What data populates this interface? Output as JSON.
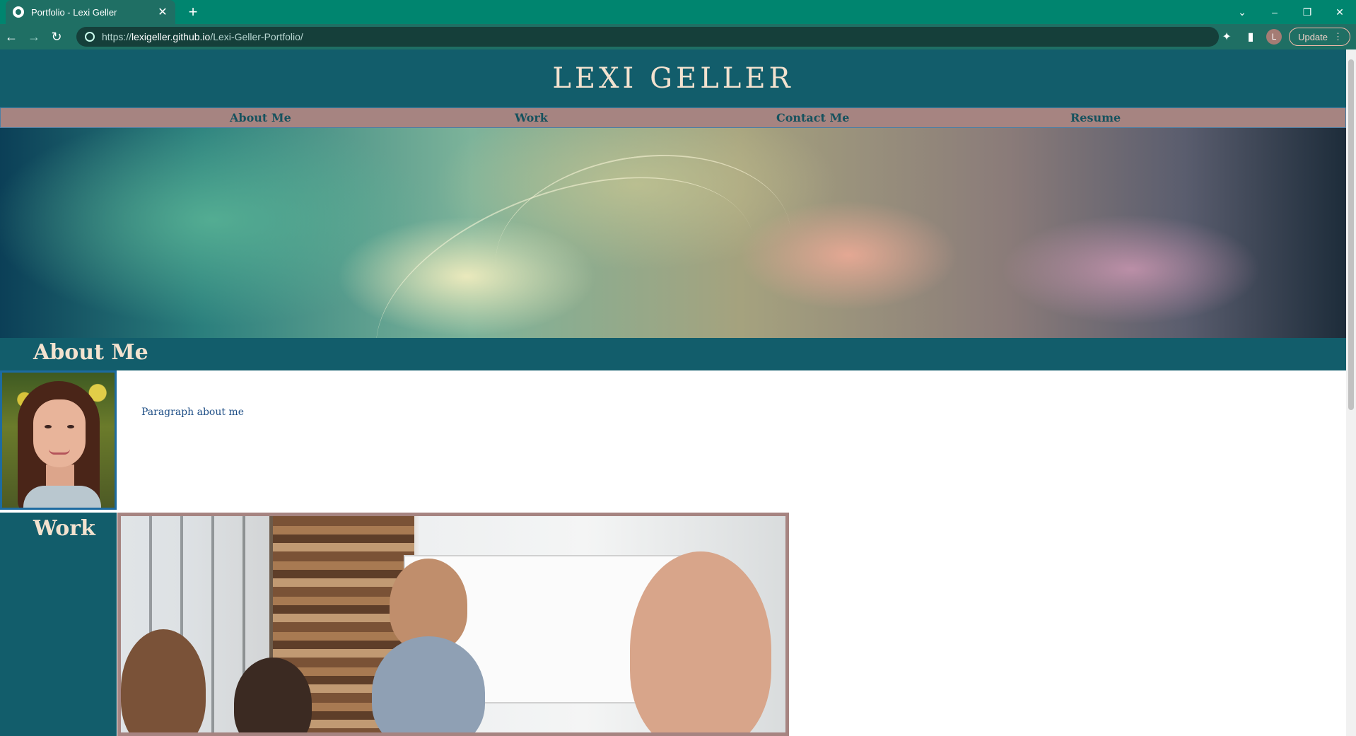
{
  "browser": {
    "tab_title": "Portfolio - Lexi Geller",
    "tab_close": "✕",
    "new_tab": "+",
    "url_scheme": "https://",
    "url_host": "lexigeller.github.io",
    "url_path": "/Lexi-Geller-Portfolio/",
    "avatar_letter": "L",
    "update_label": "Update",
    "window_controls": {
      "dropdown": "⌄",
      "minimize": "–",
      "restore": "❐",
      "close": "✕"
    },
    "nav_icons": {
      "back": "←",
      "forward": "→",
      "reload": "↻",
      "extensions": "✦",
      "side_panel": "▮",
      "menu": "⋮"
    }
  },
  "site": {
    "title": "LEXI GELLER",
    "nav": [
      {
        "label": "About Me"
      },
      {
        "label": "Work"
      },
      {
        "label": "Contact Me"
      },
      {
        "label": "Resume"
      }
    ],
    "about": {
      "heading": "About Me",
      "paragraph": "Paragraph about me"
    },
    "work": {
      "heading": "Work"
    }
  },
  "colors": {
    "tabstrip": "#00856f",
    "toolbar": "#1f6f64",
    "header": "#125d6b",
    "nav_bar": "#a68481",
    "heading_text": "#f3e2cf",
    "nav_text": "#16525e",
    "paragraph_text": "#1f4f86"
  }
}
